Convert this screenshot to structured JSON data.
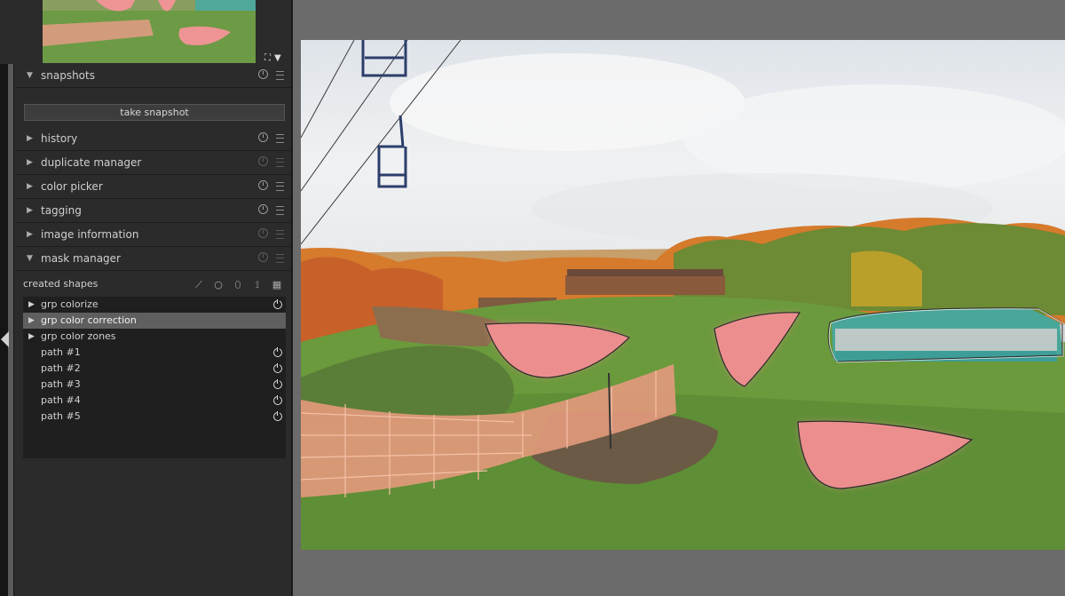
{
  "panel": {
    "modules": [
      {
        "label": "snapshots",
        "expanded": true
      },
      {
        "label": "history",
        "expanded": false
      },
      {
        "label": "duplicate manager",
        "expanded": false
      },
      {
        "label": "color picker",
        "expanded": false
      },
      {
        "label": "tagging",
        "expanded": false
      },
      {
        "label": "image information",
        "expanded": false
      },
      {
        "label": "mask manager",
        "expanded": true
      }
    ],
    "snapshots": {
      "button_label": "take snapshot"
    },
    "mask_manager": {
      "created_shapes_label": "created shapes",
      "items": [
        {
          "label": "grp colorize",
          "group": true
        },
        {
          "label": "grp color correction",
          "group": true,
          "selected": true
        },
        {
          "label": "grp color zones",
          "group": true
        },
        {
          "label": "path #1"
        },
        {
          "label": "path #2"
        },
        {
          "label": "path #3"
        },
        {
          "label": "path #4"
        },
        {
          "label": "path #5"
        }
      ]
    }
  },
  "icons": [
    "fullscreen-icon",
    "dropdown-icon",
    "reset-icon",
    "presets-menu-icon",
    "brush-icon",
    "circle-icon",
    "ellipse-icon",
    "path-icon",
    "gradient-icon",
    "power-icon",
    "collapse-panel-icon"
  ],
  "colors": {
    "panel_bg": "#2b2b2b",
    "canvas_bg": "#6b6b6b",
    "mask_overlay": "#e98c8c",
    "selected_row": "#5f5f5f"
  }
}
